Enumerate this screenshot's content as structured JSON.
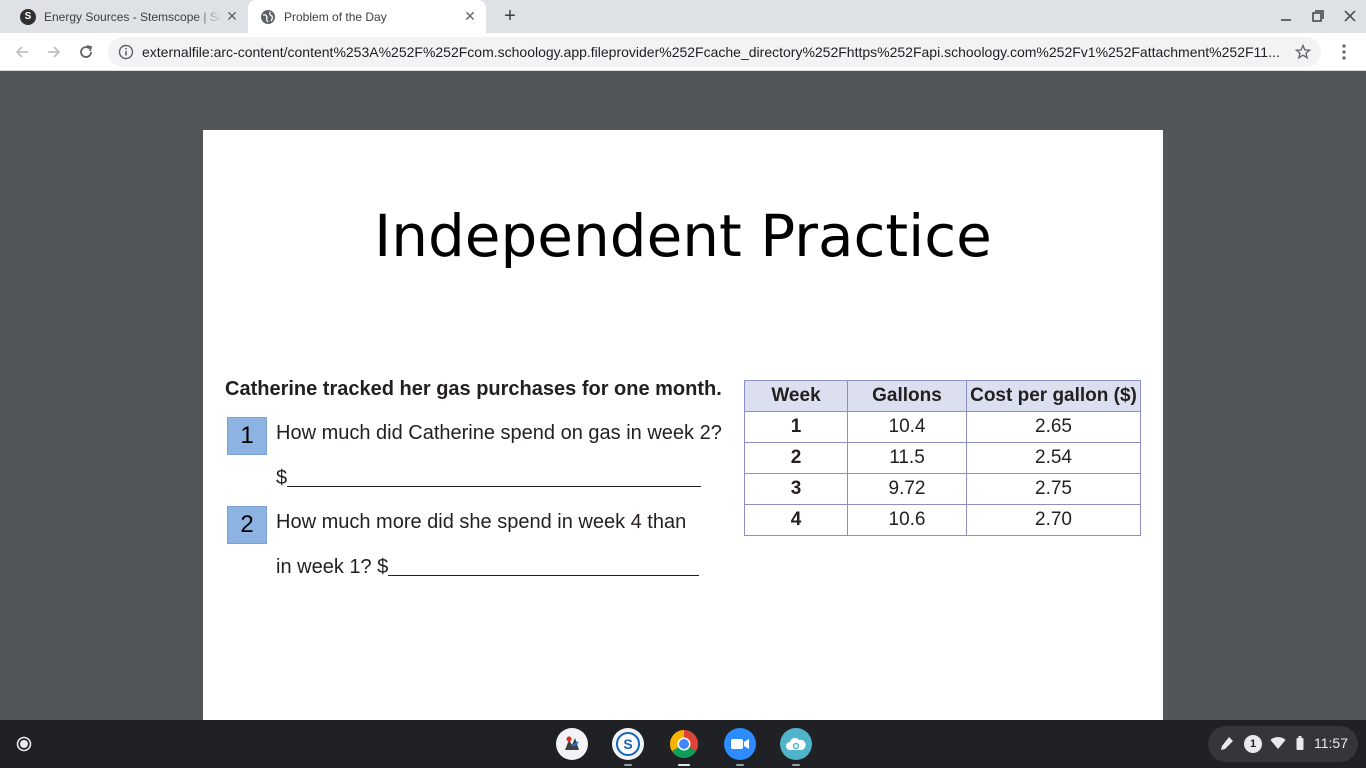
{
  "browser": {
    "tabs": [
      {
        "title": "Energy Sources - Stemscope | Sc",
        "active": false,
        "favicon": "schoology-s-icon"
      },
      {
        "title": "Problem of the Day",
        "active": true,
        "favicon": "globe-icon"
      }
    ],
    "url": "externalfile:arc-content/content%253A%252F%252Fcom.schoology.app.fileprovider%252Fcache_directory%252Fhttps%252Fapi.schoology.com%252Fv1%252Fattachment%252F11..."
  },
  "slide": {
    "title": "Independent Practice",
    "intro": "Catherine tracked her gas purchases for one month.",
    "questions": [
      {
        "number": "1",
        "line1": "How much did Catherine spend on gas in week 2?",
        "line2_prefix": "$"
      },
      {
        "number": "2",
        "line1": "How much more did she spend in week 4 than",
        "line2_prefix": "in week 1? $"
      }
    ],
    "table": {
      "headers": [
        "Week",
        "Gallons",
        "Cost per gallon ($)"
      ],
      "rows": [
        [
          "1",
          "10.4",
          "2.65"
        ],
        [
          "2",
          "11.5",
          "2.54"
        ],
        [
          "3",
          "9.72",
          "2.75"
        ],
        [
          "4",
          "10.6",
          "2.70"
        ]
      ]
    }
  },
  "shelf": {
    "apps": [
      "recorder-app-icon",
      "schoology-app-icon",
      "chrome-app-icon",
      "zoom-app-icon",
      "cloud-app-icon"
    ],
    "tray": {
      "notification_count": "1",
      "time": "11:57"
    }
  },
  "colors": {
    "question_box": "#8db3e2",
    "table_header": "#dcdff0",
    "viewer_bg": "#525659"
  }
}
